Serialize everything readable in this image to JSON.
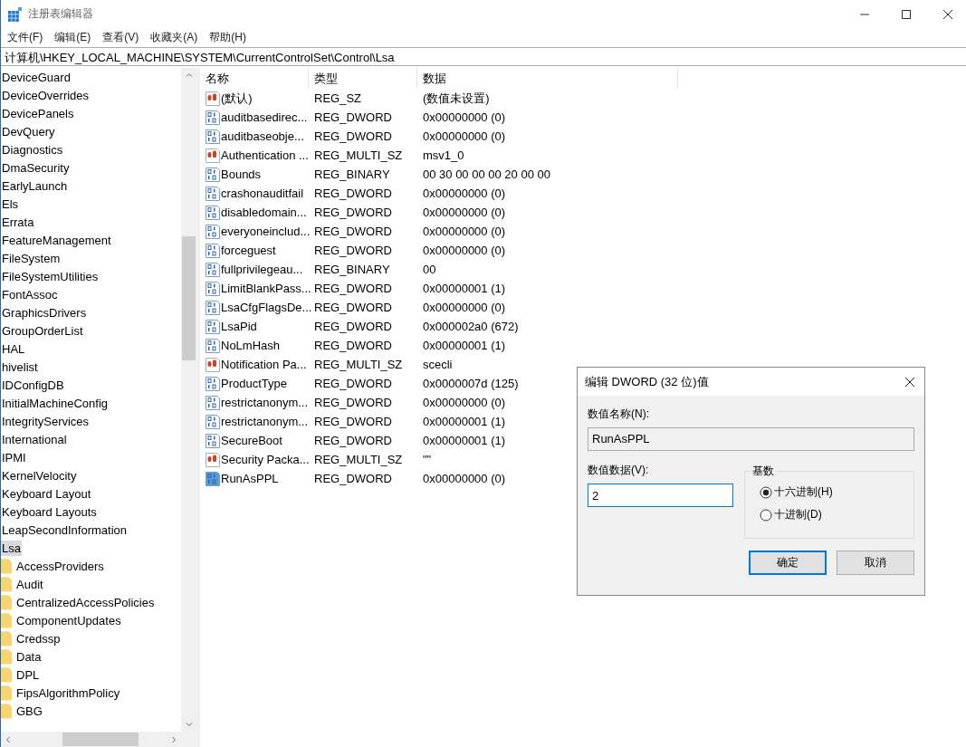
{
  "window": {
    "title": "注册表编辑器"
  },
  "menu": [
    "文件(F)",
    "编辑(E)",
    "查看(V)",
    "收藏夹(A)",
    "帮助(H)"
  ],
  "address": "计算机\\HKEY_LOCAL_MACHINE\\SYSTEM\\CurrentControlSet\\Control\\Lsa",
  "tree": [
    {
      "label": "DeviceGuard",
      "selected": false
    },
    {
      "label": "DeviceOverrides",
      "selected": false
    },
    {
      "label": "DevicePanels",
      "selected": false
    },
    {
      "label": "DevQuery",
      "selected": false
    },
    {
      "label": "Diagnostics",
      "selected": false
    },
    {
      "label": "DmaSecurity",
      "selected": false
    },
    {
      "label": "EarlyLaunch",
      "selected": false
    },
    {
      "label": "Els",
      "selected": false
    },
    {
      "label": "Errata",
      "selected": false
    },
    {
      "label": "FeatureManagement",
      "selected": false
    },
    {
      "label": "FileSystem",
      "selected": false
    },
    {
      "label": "FileSystemUtilities",
      "selected": false
    },
    {
      "label": "FontAssoc",
      "selected": false
    },
    {
      "label": "GraphicsDrivers",
      "selected": false
    },
    {
      "label": "GroupOrderList",
      "selected": false
    },
    {
      "label": "HAL",
      "selected": false
    },
    {
      "label": "hivelist",
      "selected": false
    },
    {
      "label": "IDConfigDB",
      "selected": false
    },
    {
      "label": "InitialMachineConfig",
      "selected": false
    },
    {
      "label": "IntegrityServices",
      "selected": false
    },
    {
      "label": "International",
      "selected": false
    },
    {
      "label": "IPMI",
      "selected": false
    },
    {
      "label": "KernelVelocity",
      "selected": false
    },
    {
      "label": "Keyboard Layout",
      "selected": false
    },
    {
      "label": "Keyboard Layouts",
      "selected": false
    },
    {
      "label": "LeapSecondInformation",
      "selected": false
    },
    {
      "label": "Lsa",
      "selected": true,
      "children": [
        {
          "label": "AccessProviders",
          "selected": false
        },
        {
          "label": "Audit",
          "selected": false
        },
        {
          "label": "CentralizedAccessPolicies",
          "selected": false
        },
        {
          "label": "ComponentUpdates",
          "selected": false
        },
        {
          "label": "Credssp",
          "selected": false
        },
        {
          "label": "Data",
          "selected": false
        },
        {
          "label": "DPL",
          "selected": false
        },
        {
          "label": "FipsAlgorithmPolicy",
          "selected": false
        },
        {
          "label": "GBG",
          "selected": false
        }
      ]
    }
  ],
  "table": {
    "columns": [
      "名称",
      "类型",
      "数据"
    ],
    "rows": [
      {
        "kind": "string",
        "name": "(默认)",
        "type": "REG_SZ",
        "data": "(数值未设置)",
        "selected": false
      },
      {
        "kind": "number",
        "name": "auditbasedirec...",
        "type": "REG_DWORD",
        "data": "0x00000000 (0)",
        "selected": false
      },
      {
        "kind": "number",
        "name": "auditbaseobje...",
        "type": "REG_DWORD",
        "data": "0x00000000 (0)",
        "selected": false
      },
      {
        "kind": "string",
        "name": "Authentication ...",
        "type": "REG_MULTI_SZ",
        "data": "msv1_0",
        "selected": false
      },
      {
        "kind": "number",
        "name": "Bounds",
        "type": "REG_BINARY",
        "data": "00 30 00 00 00 20 00 00",
        "selected": false
      },
      {
        "kind": "number",
        "name": "crashonauditfail",
        "type": "REG_DWORD",
        "data": "0x00000000 (0)",
        "selected": false
      },
      {
        "kind": "number",
        "name": "disabledomain...",
        "type": "REG_DWORD",
        "data": "0x00000000 (0)",
        "selected": false
      },
      {
        "kind": "number",
        "name": "everyoneinclud...",
        "type": "REG_DWORD",
        "data": "0x00000000 (0)",
        "selected": false
      },
      {
        "kind": "number",
        "name": "forceguest",
        "type": "REG_DWORD",
        "data": "0x00000000 (0)",
        "selected": false
      },
      {
        "kind": "number",
        "name": "fullprivilegeau...",
        "type": "REG_BINARY",
        "data": "00",
        "selected": false
      },
      {
        "kind": "number",
        "name": "LimitBlankPass...",
        "type": "REG_DWORD",
        "data": "0x00000001 (1)",
        "selected": false
      },
      {
        "kind": "number",
        "name": "LsaCfgFlagsDe...",
        "type": "REG_DWORD",
        "data": "0x00000000 (0)",
        "selected": false
      },
      {
        "kind": "number",
        "name": "LsaPid",
        "type": "REG_DWORD",
        "data": "0x000002a0 (672)",
        "selected": false
      },
      {
        "kind": "number",
        "name": "NoLmHash",
        "type": "REG_DWORD",
        "data": "0x00000001 (1)",
        "selected": false
      },
      {
        "kind": "string",
        "name": "Notification Pa...",
        "type": "REG_MULTI_SZ",
        "data": "scecli",
        "selected": false
      },
      {
        "kind": "number",
        "name": "ProductType",
        "type": "REG_DWORD",
        "data": "0x0000007d (125)",
        "selected": false
      },
      {
        "kind": "number",
        "name": "restrictanonym...",
        "type": "REG_DWORD",
        "data": "0x00000000 (0)",
        "selected": false
      },
      {
        "kind": "number",
        "name": "restrictanonym...",
        "type": "REG_DWORD",
        "data": "0x00000001 (1)",
        "selected": false
      },
      {
        "kind": "number",
        "name": "SecureBoot",
        "type": "REG_DWORD",
        "data": "0x00000001 (1)",
        "selected": false
      },
      {
        "kind": "string",
        "name": "Security Packa...",
        "type": "REG_MULTI_SZ",
        "data": "\"\"",
        "selected": false
      },
      {
        "kind": "number",
        "name": "RunAsPPL",
        "type": "REG_DWORD",
        "data": "0x00000000 (0)",
        "selected": true
      }
    ]
  },
  "dialog": {
    "title": "编辑 DWORD (32 位)值",
    "name_label": "数值名称(N):",
    "name_value": "RunAsPPL",
    "data_label": "数值数据(V):",
    "data_value": "2",
    "base_label": "基数",
    "base_options": [
      {
        "label": "十六进制(H)",
        "selected": true
      },
      {
        "label": "十进制(D)",
        "selected": false
      }
    ],
    "buttons": [
      {
        "label": "确定",
        "default": true
      },
      {
        "label": "取消",
        "default": false
      }
    ]
  }
}
